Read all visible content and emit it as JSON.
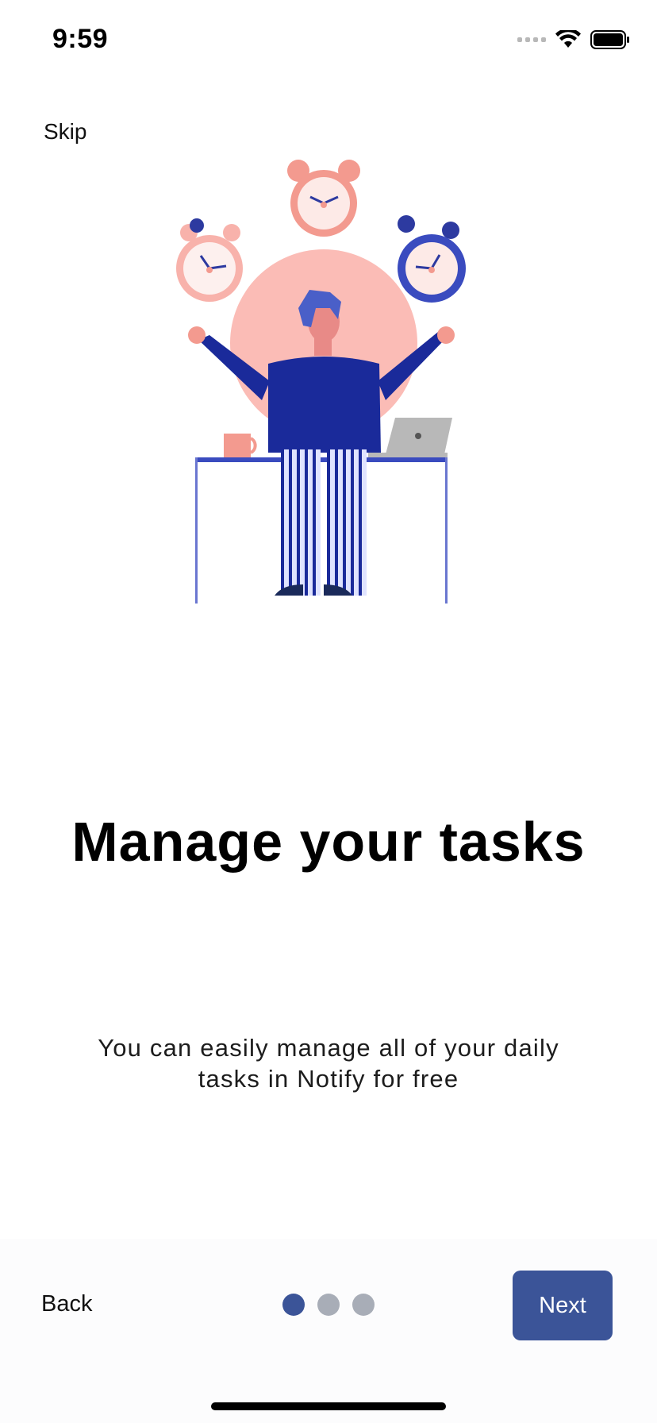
{
  "status_bar": {
    "time": "9:59",
    "icons": [
      "signal-icon",
      "wifi-icon",
      "battery-icon"
    ]
  },
  "onboarding": {
    "skip_label": "Skip",
    "illustration": "person-juggling-clocks-illustration",
    "title": "Manage your tasks",
    "subtitle": "You can easily manage all of your daily tasks in Notify for free"
  },
  "footer": {
    "back_label": "Back",
    "next_label": "Next",
    "page_count": 3,
    "current_page": 1
  },
  "colors": {
    "accent": "#3b5498",
    "dot_inactive": "#a8adb7",
    "illustration_pink": "#f8a7a0",
    "illustration_navy": "#1a2a9a"
  }
}
